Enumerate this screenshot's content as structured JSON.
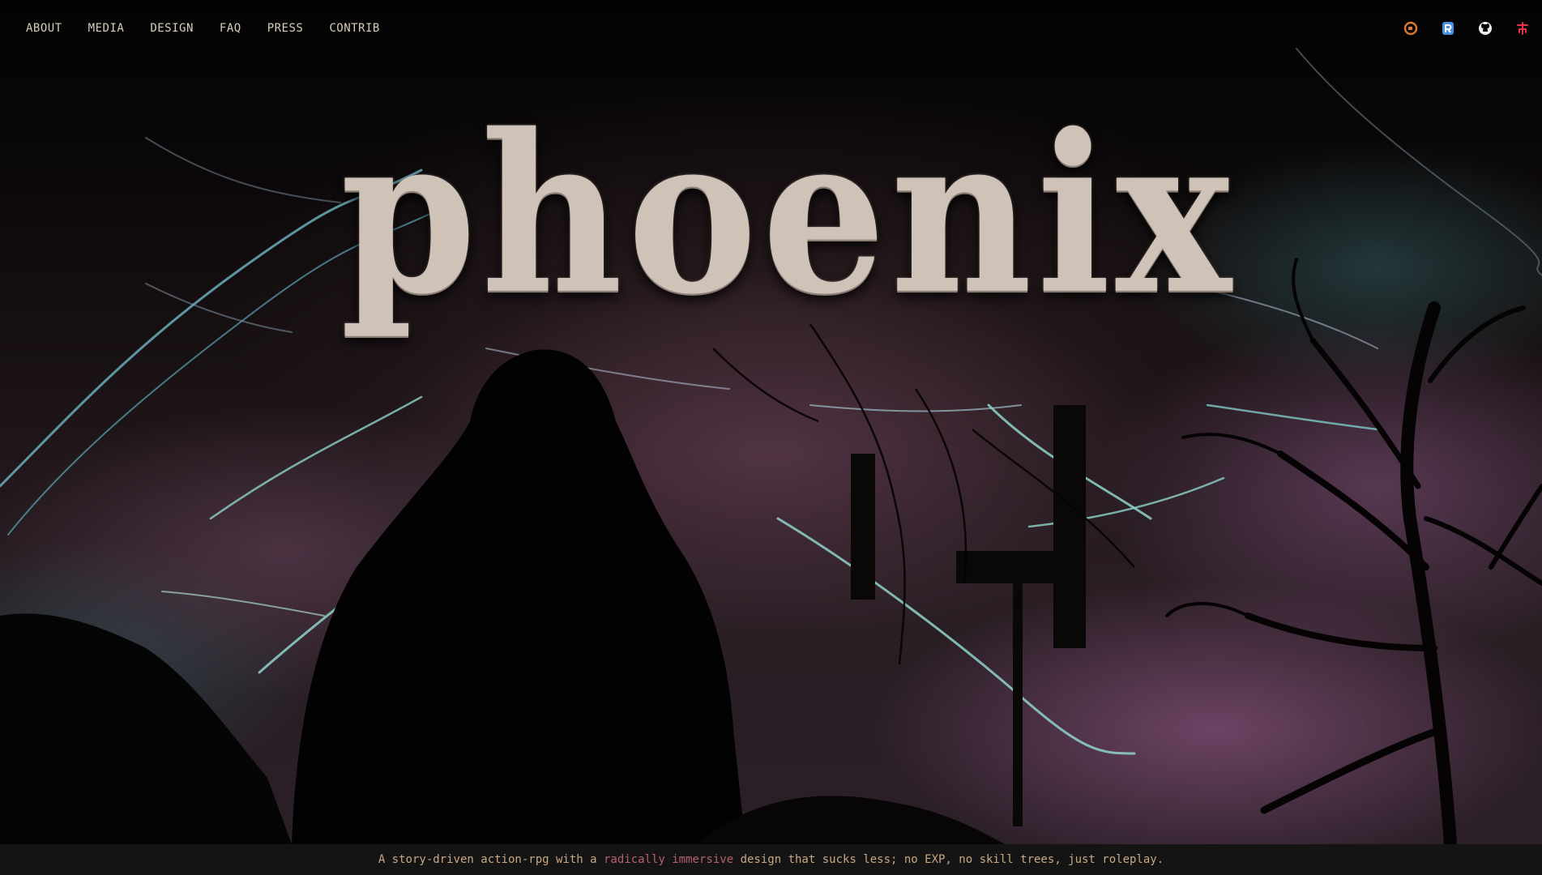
{
  "nav": {
    "links": [
      {
        "label": "ABOUT"
      },
      {
        "label": "MEDIA"
      },
      {
        "label": "DESIGN"
      },
      {
        "label": "FAQ"
      },
      {
        "label": "PRESS"
      },
      {
        "label": "CONTRIB"
      }
    ],
    "icons": [
      {
        "name": "coffee-icon",
        "color": "#e07a2e"
      },
      {
        "name": "reddit-r-icon",
        "color": "#4a90e2"
      },
      {
        "name": "github-icon",
        "color": "#f0f0f0"
      },
      {
        "name": "itch-fork-icon",
        "color": "#e8324a"
      }
    ]
  },
  "hero": {
    "logo_text": "phoenix"
  },
  "tagline": {
    "prefix": "A story-driven action-rpg with a ",
    "accent": "radically immersive",
    "suffix": " design that sucks less; no EXP, no skill trees, just roleplay."
  },
  "colors": {
    "nav_text": "#d8cdbb",
    "tagline_text": "#c9a880",
    "tagline_accent": "#b8606a",
    "lightning": "#6fc3c0"
  }
}
